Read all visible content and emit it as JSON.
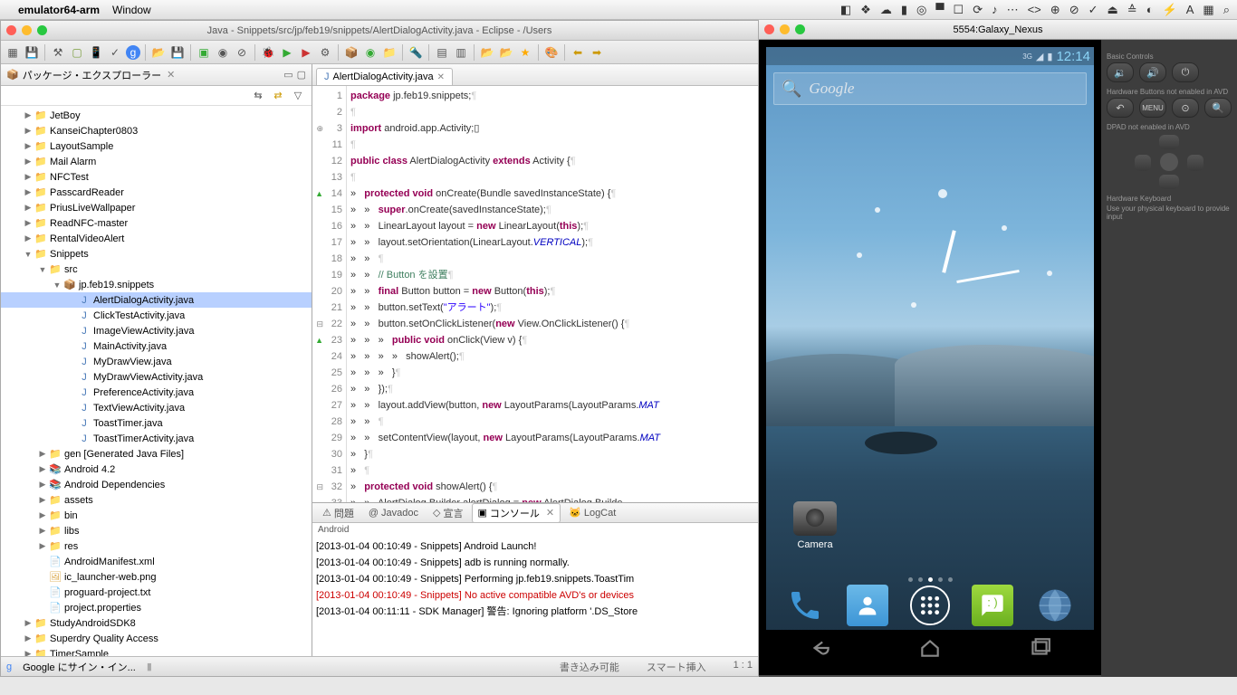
{
  "mac": {
    "app_name": "emulator64-arm",
    "menu": [
      "Window"
    ],
    "right_icons": [
      "◧",
      "❖",
      "☁",
      "▮",
      "◎",
      "▀",
      "☐",
      "⟳",
      "♪",
      "⋯",
      "<>",
      "⊕",
      "⊘",
      "✓",
      "⏏",
      "≙",
      "◐",
      "⚡",
      "A",
      "▦",
      "⌕"
    ]
  },
  "eclipse": {
    "title": "Java - Snippets/src/jp/feb19/snippets/AlertDialogActivity.java - Eclipse - /Users",
    "pkg_explorer_title": "パッケージ・エクスプローラー",
    "tree": [
      {
        "d": 1,
        "t": "folder",
        "name": "JetBoy"
      },
      {
        "d": 1,
        "t": "folder",
        "name": "KanseiChapter0803"
      },
      {
        "d": 1,
        "t": "folder",
        "name": "LayoutSample"
      },
      {
        "d": 1,
        "t": "folder",
        "name": "Mail Alarm"
      },
      {
        "d": 1,
        "t": "folder",
        "name": "NFCTest"
      },
      {
        "d": 1,
        "t": "folder",
        "name": "PasscardReader"
      },
      {
        "d": 1,
        "t": "folder",
        "name": "PriusLiveWallpaper"
      },
      {
        "d": 1,
        "t": "folder",
        "name": "ReadNFC-master"
      },
      {
        "d": 1,
        "t": "folder",
        "name": "RentalVideoAlert"
      },
      {
        "d": 1,
        "t": "folder",
        "name": "Snippets",
        "open": true
      },
      {
        "d": 2,
        "t": "src",
        "name": "src",
        "open": true
      },
      {
        "d": 3,
        "t": "pkg",
        "name": "jp.feb19.snippets",
        "open": true
      },
      {
        "d": 4,
        "t": "java",
        "name": "AlertDialogActivity.java",
        "sel": true
      },
      {
        "d": 4,
        "t": "java",
        "name": "ClickTestActivity.java"
      },
      {
        "d": 4,
        "t": "java",
        "name": "ImageViewActivity.java"
      },
      {
        "d": 4,
        "t": "java",
        "name": "MainActivity.java"
      },
      {
        "d": 4,
        "t": "java",
        "name": "MyDrawView.java"
      },
      {
        "d": 4,
        "t": "java",
        "name": "MyDrawViewActivity.java"
      },
      {
        "d": 4,
        "t": "java",
        "name": "PreferenceActivity.java"
      },
      {
        "d": 4,
        "t": "java",
        "name": "TextViewActivity.java"
      },
      {
        "d": 4,
        "t": "java",
        "name": "ToastTimer.java"
      },
      {
        "d": 4,
        "t": "java",
        "name": "ToastTimerActivity.java"
      },
      {
        "d": 2,
        "t": "gen",
        "name": "gen [Generated Java Files]"
      },
      {
        "d": 2,
        "t": "lib",
        "name": "Android 4.2"
      },
      {
        "d": 2,
        "t": "lib",
        "name": "Android Dependencies"
      },
      {
        "d": 2,
        "t": "folder",
        "name": "assets"
      },
      {
        "d": 2,
        "t": "folder",
        "name": "bin"
      },
      {
        "d": 2,
        "t": "folder",
        "name": "libs"
      },
      {
        "d": 2,
        "t": "folder",
        "name": "res"
      },
      {
        "d": 2,
        "t": "xml",
        "name": "AndroidManifest.xml"
      },
      {
        "d": 2,
        "t": "png",
        "name": "ic_launcher-web.png"
      },
      {
        "d": 2,
        "t": "txt",
        "name": "proguard-project.txt"
      },
      {
        "d": 2,
        "t": "txt",
        "name": "project.properties"
      },
      {
        "d": 1,
        "t": "folder",
        "name": "StudyAndroidSDK8"
      },
      {
        "d": 1,
        "t": "folder",
        "name": "Superdry Quality Access"
      },
      {
        "d": 1,
        "t": "folder",
        "name": "TimerSample"
      }
    ],
    "editor_tab": "AlertDialogActivity.java",
    "code_lines": [
      {
        "n": 1,
        "html": "<span class='kw'>package</span> jp.feb19.snippets;<span class='pilcrow'>¶</span>"
      },
      {
        "n": 2,
        "html": "<span class='pilcrow'>¶</span>"
      },
      {
        "n": 3,
        "mark": "⊕",
        "html": "<span class='kw'>import</span> android.app.Activity;▯"
      },
      {
        "n": 11,
        "html": "<span class='pilcrow'>¶</span>"
      },
      {
        "n": 12,
        "html": "<span class='kw'>public class</span> AlertDialogActivity <span class='kw'>extends</span> Activity {<span class='pilcrow'>¶</span>"
      },
      {
        "n": 13,
        "html": "<span class='pilcrow'>¶</span>"
      },
      {
        "n": 14,
        "mark": "▲",
        "html": "»   <span class='kw'>protected void</span> onCreate(Bundle savedInstanceState) {<span class='pilcrow'>¶</span>"
      },
      {
        "n": 15,
        "html": "»   »   <span class='kw'>super</span>.onCreate(savedInstanceState);<span class='pilcrow'>¶</span>"
      },
      {
        "n": 16,
        "html": "»   »   LinearLayout layout = <span class='kw'>new</span> LinearLayout(<span class='kw'>this</span>);<span class='pilcrow'>¶</span>"
      },
      {
        "n": 17,
        "html": "»   »   layout.setOrientation(LinearLayout.<span class='field'>VERTICAL</span>);<span class='pilcrow'>¶</span>"
      },
      {
        "n": 18,
        "html": "»   »   <span class='pilcrow'>¶</span>"
      },
      {
        "n": 19,
        "html": "»   »   <span class='com'>// Button を設置</span><span class='pilcrow'>¶</span>"
      },
      {
        "n": 20,
        "html": "»   »   <span class='kw'>final</span> Button button = <span class='kw'>new</span> Button(<span class='kw'>this</span>);<span class='pilcrow'>¶</span>"
      },
      {
        "n": 21,
        "html": "»   »   button.setText(<span class='str'>\"アラート\"</span>);<span class='pilcrow'>¶</span>"
      },
      {
        "n": 22,
        "mark": "⊟",
        "html": "»   »   button.setOnClickListener(<span class='kw'>new</span> View.OnClickListener() {<span class='pilcrow'>¶</span>"
      },
      {
        "n": 23,
        "mark": "▲",
        "html": "»   »   »   <span class='kw'>public void</span> onClick(View v) {<span class='pilcrow'>¶</span>"
      },
      {
        "n": 24,
        "html": "»   »   »   »   showAlert();<span class='pilcrow'>¶</span>"
      },
      {
        "n": 25,
        "html": "»   »   »   }<span class='pilcrow'>¶</span>"
      },
      {
        "n": 26,
        "html": "»   »   });<span class='pilcrow'>¶</span>"
      },
      {
        "n": 27,
        "html": "»   »   layout.addView(button, <span class='kw'>new</span> LayoutParams(LayoutParams.<span class='field'>MAT</span>"
      },
      {
        "n": 28,
        "html": "»   »   <span class='pilcrow'>¶</span>"
      },
      {
        "n": 29,
        "html": "»   »   setContentView(layout, <span class='kw'>new</span> LayoutParams(LayoutParams.<span class='field'>MAT</span>"
      },
      {
        "n": 30,
        "html": "»   }<span class='pilcrow'>¶</span>"
      },
      {
        "n": 31,
        "html": "»   <span class='pilcrow'>¶</span>"
      },
      {
        "n": 32,
        "mark": "⊟",
        "html": "»   <span class='kw'>protected void</span> showAlert() {<span class='pilcrow'>¶</span>"
      },
      {
        "n": 33,
        "html": "»   »   AlertDialog.Builder alertDialog = <span class='kw'>new</span> AlertDialog.Builde"
      }
    ],
    "console_tabs": [
      {
        "icon": "⚠",
        "label": "問題"
      },
      {
        "icon": "@",
        "label": "Javadoc"
      },
      {
        "icon": "◇",
        "label": "宣言"
      },
      {
        "icon": "▣",
        "label": "コンソール",
        "active": true
      },
      {
        "icon": "🐱",
        "label": "LogCat"
      }
    ],
    "console_label": "Android",
    "console_lines": [
      {
        "text": "[2013-01-04 00:10:49 - Snippets] Android Launch!"
      },
      {
        "text": "[2013-01-04 00:10:49 - Snippets] adb is running normally."
      },
      {
        "text": "[2013-01-04 00:10:49 - Snippets] Performing jp.feb19.snippets.ToastTim"
      },
      {
        "text": "[2013-01-04 00:10:49 - Snippets] No active compatible AVD's or devices",
        "err": true
      },
      {
        "text": "[2013-01-04 00:11:11 - SDK Manager] 警告: Ignoring platform '.DS_Store"
      }
    ],
    "status_left": "Google にサイン・イン...",
    "status_right": [
      "書き込み可能",
      "スマート挿入",
      "1 : 1"
    ]
  },
  "emulator": {
    "title": "5554:Galaxy_Nexus",
    "clock": "12:14",
    "search_text": "Google",
    "camera_label": "Camera",
    "ctrl_labels": {
      "basic": "Basic Controls",
      "hw": "Hardware Buttons not enabled in AVD",
      "dpad": "DPAD not enabled in AVD",
      "kbd": "Hardware Keyboard",
      "kbd_sub": "Use your physical keyboard to provide input"
    }
  }
}
